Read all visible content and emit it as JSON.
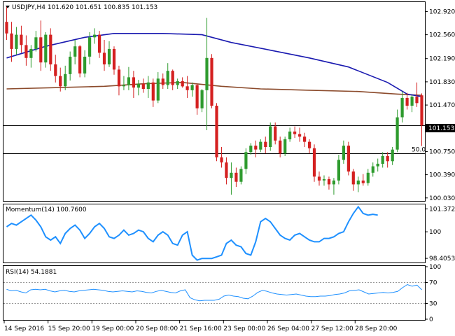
{
  "chart_data": {
    "type": "candlestick",
    "symbol": "USDJPY",
    "timeframe": "H4",
    "ohlc_header": {
      "open": "101.620",
      "high": "101.651",
      "low": "100.835",
      "close": "101.153"
    },
    "title": "USDJPY,H4  101.620 101.651 100.835 101.153",
    "price_axis": {
      "ticks": [
        "102.920",
        "102.560",
        "102.190",
        "101.830",
        "101.470",
        "100.750",
        "100.390",
        "100.030"
      ],
      "ylim": [
        99.995,
        103.055
      ]
    },
    "current_price_label": "101.153",
    "horizontal_lines": [
      {
        "value": 101.153,
        "label": ""
      },
      {
        "value": 100.72,
        "label": "50.0"
      }
    ],
    "time_labels": [
      "14 Sep 2016",
      "15 Sep 20:00",
      "19 Sep 00:00",
      "20 Sep 08:00",
      "21 Sep 16:00",
      "23 Sep 00:00",
      "26 Sep 04:00",
      "27 Sep 12:00",
      "28 Sep 20:00"
    ],
    "candles": [
      {
        "o": 102.76,
        "h": 103.0,
        "l": 102.48,
        "c": 102.58
      },
      {
        "o": 102.58,
        "h": 102.76,
        "l": 102.14,
        "c": 102.34
      },
      {
        "o": 102.34,
        "h": 102.68,
        "l": 102.25,
        "c": 102.56
      },
      {
        "o": 102.56,
        "h": 102.7,
        "l": 102.28,
        "c": 102.4
      },
      {
        "o": 102.4,
        "h": 102.55,
        "l": 102.08,
        "c": 102.2
      },
      {
        "o": 102.2,
        "h": 102.4,
        "l": 102.05,
        "c": 102.34
      },
      {
        "o": 102.34,
        "h": 102.62,
        "l": 102.3,
        "c": 102.52
      },
      {
        "o": 102.52,
        "h": 102.78,
        "l": 102.0,
        "c": 102.13
      },
      {
        "o": 102.13,
        "h": 102.6,
        "l": 102.05,
        "c": 102.56
      },
      {
        "o": 102.56,
        "h": 102.66,
        "l": 102.0,
        "c": 102.1
      },
      {
        "o": 102.1,
        "h": 102.25,
        "l": 101.82,
        "c": 101.92
      },
      {
        "o": 101.92,
        "h": 102.05,
        "l": 101.68,
        "c": 101.76
      },
      {
        "o": 101.76,
        "h": 102.08,
        "l": 101.7,
        "c": 101.95
      },
      {
        "o": 101.95,
        "h": 102.3,
        "l": 101.85,
        "c": 102.22
      },
      {
        "o": 102.22,
        "h": 102.48,
        "l": 102.1,
        "c": 102.38
      },
      {
        "o": 102.38,
        "h": 102.4,
        "l": 101.9,
        "c": 101.96
      },
      {
        "o": 101.96,
        "h": 102.32,
        "l": 101.9,
        "c": 102.22
      },
      {
        "o": 102.22,
        "h": 102.6,
        "l": 102.1,
        "c": 102.52
      },
      {
        "o": 102.52,
        "h": 102.66,
        "l": 102.42,
        "c": 102.56
      },
      {
        "o": 102.56,
        "h": 102.62,
        "l": 102.2,
        "c": 102.28
      },
      {
        "o": 102.28,
        "h": 102.48,
        "l": 102.0,
        "c": 102.1
      },
      {
        "o": 102.1,
        "h": 102.46,
        "l": 102.06,
        "c": 102.34
      },
      {
        "o": 102.34,
        "h": 102.38,
        "l": 101.94,
        "c": 102.02
      },
      {
        "o": 102.02,
        "h": 102.08,
        "l": 101.62,
        "c": 101.76
      },
      {
        "o": 101.76,
        "h": 101.92,
        "l": 101.7,
        "c": 101.78
      },
      {
        "o": 101.78,
        "h": 102.06,
        "l": 101.7,
        "c": 101.9
      },
      {
        "o": 101.9,
        "h": 102.0,
        "l": 101.58,
        "c": 101.74
      },
      {
        "o": 101.74,
        "h": 101.86,
        "l": 101.62,
        "c": 101.8
      },
      {
        "o": 101.8,
        "h": 101.88,
        "l": 101.66,
        "c": 101.72
      },
      {
        "o": 101.72,
        "h": 101.92,
        "l": 101.58,
        "c": 101.82
      },
      {
        "o": 101.82,
        "h": 101.88,
        "l": 101.44,
        "c": 101.54
      },
      {
        "o": 101.54,
        "h": 101.98,
        "l": 101.5,
        "c": 101.88
      },
      {
        "o": 101.88,
        "h": 101.96,
        "l": 101.72,
        "c": 101.78
      },
      {
        "o": 101.78,
        "h": 102.12,
        "l": 101.72,
        "c": 102.0
      },
      {
        "o": 102.0,
        "h": 102.02,
        "l": 101.7,
        "c": 101.78
      },
      {
        "o": 101.78,
        "h": 101.88,
        "l": 101.72,
        "c": 101.84
      },
      {
        "o": 101.84,
        "h": 101.9,
        "l": 101.74,
        "c": 101.76
      },
      {
        "o": 101.76,
        "h": 101.92,
        "l": 101.58,
        "c": 101.7
      },
      {
        "o": 101.7,
        "h": 101.82,
        "l": 101.6,
        "c": 101.78
      },
      {
        "o": 101.78,
        "h": 101.8,
        "l": 101.32,
        "c": 101.42
      },
      {
        "o": 101.42,
        "h": 101.72,
        "l": 101.36,
        "c": 101.7
      },
      {
        "o": 101.7,
        "h": 102.82,
        "l": 101.08,
        "c": 102.2
      },
      {
        "o": 102.2,
        "h": 102.26,
        "l": 101.42,
        "c": 101.46
      },
      {
        "o": 101.46,
        "h": 101.5,
        "l": 100.6,
        "c": 100.66
      },
      {
        "o": 100.66,
        "h": 100.82,
        "l": 100.5,
        "c": 100.58
      },
      {
        "o": 100.58,
        "h": 100.66,
        "l": 100.24,
        "c": 100.34
      },
      {
        "o": 100.34,
        "h": 100.58,
        "l": 100.08,
        "c": 100.42
      },
      {
        "o": 100.42,
        "h": 100.5,
        "l": 100.2,
        "c": 100.28
      },
      {
        "o": 100.28,
        "h": 100.52,
        "l": 100.24,
        "c": 100.48
      },
      {
        "o": 100.48,
        "h": 100.8,
        "l": 100.4,
        "c": 100.74
      },
      {
        "o": 100.74,
        "h": 100.88,
        "l": 100.7,
        "c": 100.84
      },
      {
        "o": 100.84,
        "h": 100.92,
        "l": 100.66,
        "c": 100.78
      },
      {
        "o": 100.78,
        "h": 100.94,
        "l": 100.74,
        "c": 100.9
      },
      {
        "o": 100.9,
        "h": 100.98,
        "l": 100.72,
        "c": 100.82
      },
      {
        "o": 100.82,
        "h": 101.2,
        "l": 100.76,
        "c": 101.14
      },
      {
        "o": 101.14,
        "h": 101.2,
        "l": 100.86,
        "c": 100.92
      },
      {
        "o": 100.92,
        "h": 100.98,
        "l": 100.66,
        "c": 100.72
      },
      {
        "o": 100.72,
        "h": 100.98,
        "l": 100.68,
        "c": 100.94
      },
      {
        "o": 100.94,
        "h": 101.12,
        "l": 100.9,
        "c": 101.06
      },
      {
        "o": 101.06,
        "h": 101.14,
        "l": 100.96,
        "c": 101.02
      },
      {
        "o": 101.02,
        "h": 101.12,
        "l": 100.9,
        "c": 100.98
      },
      {
        "o": 100.98,
        "h": 101.04,
        "l": 100.82,
        "c": 100.9
      },
      {
        "o": 100.9,
        "h": 100.94,
        "l": 100.72,
        "c": 100.8
      },
      {
        "o": 100.8,
        "h": 100.86,
        "l": 100.28,
        "c": 100.36
      },
      {
        "o": 100.36,
        "h": 100.44,
        "l": 100.22,
        "c": 100.3
      },
      {
        "o": 100.3,
        "h": 100.38,
        "l": 100.22,
        "c": 100.32
      },
      {
        "o": 100.32,
        "h": 100.36,
        "l": 100.16,
        "c": 100.24
      },
      {
        "o": 100.24,
        "h": 100.34,
        "l": 100.08,
        "c": 100.3
      },
      {
        "o": 100.3,
        "h": 100.7,
        "l": 100.24,
        "c": 100.62
      },
      {
        "o": 100.62,
        "h": 100.92,
        "l": 100.56,
        "c": 100.84
      },
      {
        "o": 100.84,
        "h": 100.9,
        "l": 100.38,
        "c": 100.44
      },
      {
        "o": 100.44,
        "h": 100.48,
        "l": 100.14,
        "c": 100.24
      },
      {
        "o": 100.24,
        "h": 100.36,
        "l": 100.12,
        "c": 100.3
      },
      {
        "o": 100.3,
        "h": 100.4,
        "l": 100.22,
        "c": 100.26
      },
      {
        "o": 100.26,
        "h": 100.48,
        "l": 100.22,
        "c": 100.42
      },
      {
        "o": 100.42,
        "h": 100.58,
        "l": 100.36,
        "c": 100.52
      },
      {
        "o": 100.52,
        "h": 100.64,
        "l": 100.44,
        "c": 100.56
      },
      {
        "o": 100.56,
        "h": 100.74,
        "l": 100.5,
        "c": 100.68
      },
      {
        "o": 100.68,
        "h": 100.74,
        "l": 100.5,
        "c": 100.6
      },
      {
        "o": 100.6,
        "h": 100.82,
        "l": 100.54,
        "c": 100.78
      },
      {
        "o": 100.78,
        "h": 101.4,
        "l": 100.74,
        "c": 101.28
      },
      {
        "o": 101.28,
        "h": 101.68,
        "l": 101.2,
        "c": 101.58
      },
      {
        "o": 101.58,
        "h": 101.66,
        "l": 101.4,
        "c": 101.46
      },
      {
        "o": 101.46,
        "h": 101.62,
        "l": 101.36,
        "c": 101.6
      },
      {
        "o": 101.6,
        "h": 101.82,
        "l": 101.44,
        "c": 101.5
      },
      {
        "o": 101.62,
        "h": 101.651,
        "l": 100.835,
        "c": 101.153
      }
    ],
    "ma_blue": [
      {
        "i": 0,
        "v": 102.2
      },
      {
        "i": 8,
        "v": 102.38
      },
      {
        "i": 16,
        "v": 102.52
      },
      {
        "i": 22,
        "v": 102.58
      },
      {
        "i": 32,
        "v": 102.58
      },
      {
        "i": 40,
        "v": 102.56
      },
      {
        "i": 46,
        "v": 102.44
      },
      {
        "i": 54,
        "v": 102.32
      },
      {
        "i": 62,
        "v": 102.2
      },
      {
        "i": 70,
        "v": 102.06
      },
      {
        "i": 78,
        "v": 101.82
      },
      {
        "i": 82,
        "v": 101.64
      },
      {
        "i": 85,
        "v": 101.6
      }
    ],
    "ma_brown": [
      {
        "i": 0,
        "v": 101.72
      },
      {
        "i": 10,
        "v": 101.74
      },
      {
        "i": 20,
        "v": 101.76
      },
      {
        "i": 28,
        "v": 101.8
      },
      {
        "i": 36,
        "v": 101.82
      },
      {
        "i": 44,
        "v": 101.76
      },
      {
        "i": 52,
        "v": 101.72
      },
      {
        "i": 62,
        "v": 101.7
      },
      {
        "i": 72,
        "v": 101.68
      },
      {
        "i": 80,
        "v": 101.64
      },
      {
        "i": 85,
        "v": 101.62
      }
    ],
    "momentum": {
      "label": "Momentum(14) 100.7600",
      "ticks": [
        "101.3729",
        "100",
        "98.4053"
      ],
      "ylim": [
        98.2,
        101.6
      ],
      "values": [
        100.3,
        100.5,
        100.4,
        100.6,
        100.8,
        101.0,
        100.7,
        100.3,
        99.7,
        99.5,
        99.7,
        99.3,
        99.9,
        100.2,
        100.4,
        100.1,
        99.6,
        99.9,
        100.3,
        100.5,
        100.2,
        99.7,
        99.6,
        99.8,
        100.1,
        99.8,
        99.9,
        100.1,
        100.0,
        99.6,
        99.4,
        99.8,
        100.0,
        99.8,
        99.3,
        99.2,
        99.8,
        100.0,
        98.6,
        98.3,
        98.4,
        98.4,
        98.4,
        98.5,
        98.6,
        99.3,
        99.5,
        99.2,
        99.1,
        98.7,
        98.6,
        99.4,
        100.6,
        100.8,
        100.6,
        100.2,
        99.8,
        99.6,
        99.5,
        99.8,
        99.9,
        99.7,
        99.5,
        99.4,
        99.4,
        99.6,
        99.6,
        99.7,
        99.9,
        100.0,
        100.6,
        101.1,
        101.5,
        101.1,
        101.0,
        101.05,
        101.0
      ]
    },
    "rsi": {
      "label": "RSI(14) 54.1881",
      "ticks": [
        "100",
        "70",
        "30",
        "0"
      ],
      "ylim": [
        0,
        100
      ],
      "values": [
        57,
        54,
        55,
        52,
        50,
        56,
        57,
        56,
        57,
        54,
        52,
        54,
        55,
        53,
        52,
        54,
        55,
        56,
        57,
        56,
        55,
        53,
        52,
        53,
        54,
        53,
        52,
        54,
        53,
        51,
        50,
        53,
        55,
        53,
        51,
        50,
        54,
        56,
        41,
        37,
        35,
        36,
        36,
        36,
        38,
        44,
        46,
        44,
        43,
        40,
        39,
        44,
        51,
        55,
        53,
        50,
        48,
        47,
        46,
        47,
        48,
        46,
        44,
        43,
        43,
        44,
        44,
        45,
        47,
        48,
        50,
        54,
        55,
        56,
        52,
        48,
        49,
        50,
        51,
        50,
        51,
        53,
        60,
        66,
        63,
        65,
        56
      ]
    }
  }
}
